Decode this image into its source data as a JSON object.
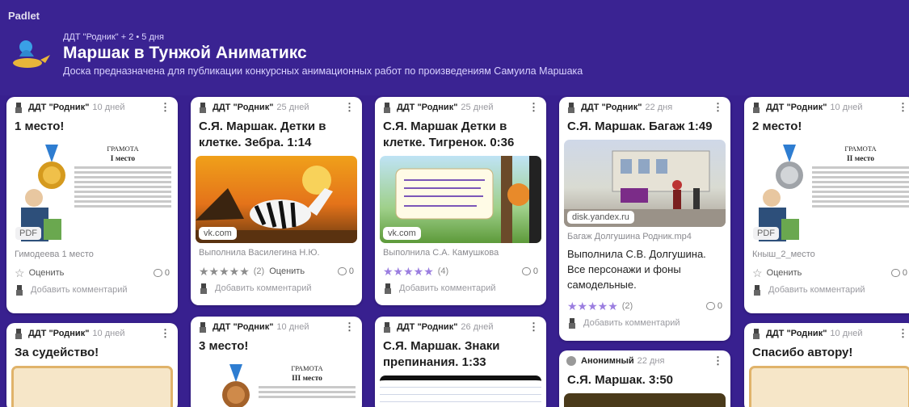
{
  "app": {
    "logo": "Padlet"
  },
  "header": {
    "meta": "ДДТ \"Родник\" + 2 • 5 дня",
    "title": "Маршак в Тунжой Аниматикс",
    "description": "Доска предназначена для публикации конкурсных анимационных работ по произведениям Самуила Маршака"
  },
  "cards": {
    "c1": {
      "author": "ДДТ \"Родник\"",
      "age": "10 дней",
      "title": "1 место!",
      "cert_title": "ГРАМОТА",
      "cert_place": "I место",
      "file_tag": "PDF",
      "caption": "Гимодеева 1 место",
      "rate_label": "Оценить",
      "comments": "0",
      "add_comment": "Добавить комментарий"
    },
    "c2": {
      "author": "ДДТ \"Родник\"",
      "age": "25 дней",
      "title": "С.Я. Маршак. Детки в клетке. Зебра. 1:14",
      "link": "vk.com",
      "caption": "Выполнила Василегина Н.Ю.",
      "rating_count": "(2)",
      "rate_label": "Оценить",
      "comments": "0",
      "add_comment": "Добавить комментарий"
    },
    "c3": {
      "author": "ДДТ \"Родник\"",
      "age": "25 дней",
      "title": "С.Я. Маршак Детки в клетке. Тигренок. 0:36",
      "link": "vk.com",
      "caption": "Выполнила С.А. Камушкова",
      "rating_count": "(4)",
      "comments": "0",
      "add_comment": "Добавить комментарий"
    },
    "c4": {
      "author": "ДДТ \"Родник\"",
      "age": "22 дня",
      "title": "С.Я. Маршак. Багаж 1:49",
      "link": "disk.yandex.ru",
      "caption": "Багаж Долгушина Родник.mp4",
      "body": "Выполнила С.В. Долгушина. Все персонажи и фоны самодельные.",
      "rating_count": "(2)",
      "comments": "0",
      "add_comment": "Добавить комментарий"
    },
    "c5": {
      "author": "ДДТ \"Родник\"",
      "age": "10 дней",
      "title": "2 место!",
      "cert_title": "ГРАМОТА",
      "cert_place": "II место",
      "file_tag": "PDF",
      "caption": "Кныш_2_место",
      "rate_label": "Оценить",
      "comments": "0",
      "add_comment": "Добавить комментарий"
    },
    "c6": {
      "author": "ДДТ \"Родник\"",
      "age": "10 дней",
      "title": "За судейство!"
    },
    "c7": {
      "author": "ДДТ \"Родник\"",
      "age": "10 дней",
      "title": "3 место!",
      "cert_title": "ГРАМОТА",
      "cert_place": "III место"
    },
    "c8": {
      "author": "ДДТ \"Родник\"",
      "age": "26 дней",
      "title": "С.Я. Маршак. Знаки препинания. 1:33"
    },
    "c9": {
      "author": "Анонимный",
      "age": "22 дня",
      "title": "С.Я. Маршак. 3:50"
    },
    "c10": {
      "author": "ДДТ \"Родник\"",
      "age": "10 дней",
      "title": "Спасибо автору!"
    }
  },
  "colors": {
    "background": "#38208f",
    "star": "#9b7ee0"
  }
}
